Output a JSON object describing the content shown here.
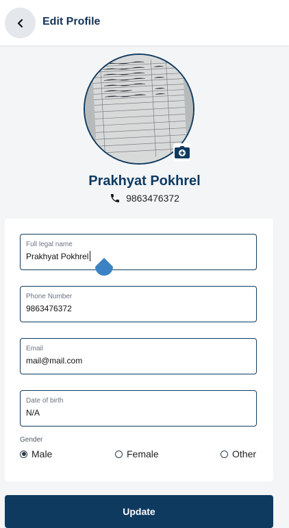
{
  "header": {
    "title": "Edit Profile",
    "back_icon": "chevron-left-icon"
  },
  "profile": {
    "name": "Prakhyat Pokhrel",
    "phone": "9863476372",
    "avatar_icon": "document-photo",
    "camera_icon": "camera-add-icon"
  },
  "form": {
    "full_name": {
      "label": "Full legal name",
      "value": "Prakhyat Pokhrel"
    },
    "phone": {
      "label": "Phone Number",
      "value": "9863476372"
    },
    "email": {
      "label": "Email",
      "value": "mail@mail.com"
    },
    "dob": {
      "label": "Date of birth",
      "value": "N/A"
    },
    "gender": {
      "label": "Gender",
      "options": [
        "Male",
        "Female",
        "Other"
      ],
      "selected": "Male"
    }
  },
  "actions": {
    "update_label": "Update"
  },
  "colors": {
    "primary": "#0f3a60",
    "background": "#f4f5f7",
    "card": "#ffffff",
    "cursor_handle": "#3b82c4"
  }
}
